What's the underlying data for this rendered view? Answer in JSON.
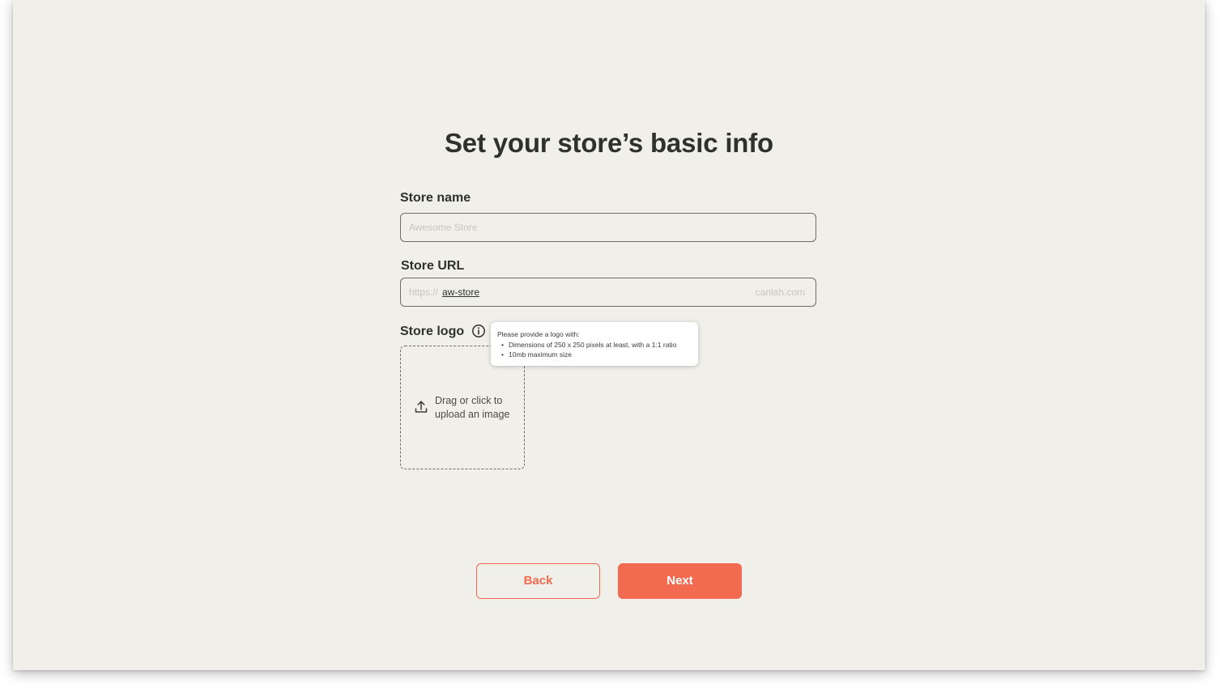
{
  "page": {
    "title": "Set your store’s basic info"
  },
  "store_name": {
    "label": "Store name",
    "value": "",
    "placeholder": "Awesome Store"
  },
  "store_url": {
    "label": "Store URL",
    "prefix": "https://",
    "slug": "aw-store",
    "suffix": "canlah.com"
  },
  "store_logo": {
    "label": "Store logo",
    "info_icon": "info-circle-icon",
    "dropzone_line1": "Drag or click to",
    "dropzone_line2": "upload an image",
    "upload_icon": "upload-icon"
  },
  "tooltip": {
    "intro": "Please provide a logo with:",
    "items": [
      "Dimensions of 250 x 250 pixels at least, with a 1:1 ratio",
      "10mb maximum size"
    ]
  },
  "actions": {
    "back_label": "Back",
    "next_label": "Next"
  },
  "colors": {
    "background": "#f0efea",
    "accent": "#f26a4f",
    "text": "#2f312e",
    "placeholder": "#c6c6c1"
  }
}
